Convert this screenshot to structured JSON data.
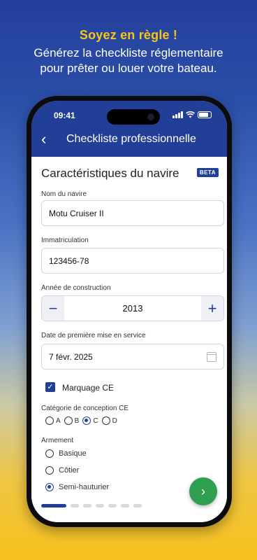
{
  "promo": {
    "headline": "Soyez en règle !",
    "subline1": "Générez la checkliste réglementaire",
    "subline2": "pour prêter ou louer votre bateau."
  },
  "status_bar": {
    "time": "09:41"
  },
  "app_bar": {
    "back_icon": "‹",
    "title": "Checkliste professionnelle"
  },
  "section": {
    "title": "Caractéristiques du navire",
    "badge": "BETA"
  },
  "form": {
    "vessel_name": {
      "label": "Nom du navire",
      "value": "Motu Cruiser II"
    },
    "registration": {
      "label": "Immatriculation",
      "value": "123456-78"
    },
    "build_year": {
      "label": "Année de construction",
      "value": "2013",
      "minus": "−",
      "plus": "+"
    },
    "service_date": {
      "label": "Date de première mise en service",
      "value": "7 févr. 2025"
    },
    "ce_marking": {
      "label": "Marquage CE",
      "checked": true,
      "check": "✓"
    },
    "design_category": {
      "label": "Catégorie de conception CE",
      "options": [
        "A",
        "B",
        "C",
        "D"
      ],
      "selected": "C"
    },
    "armament": {
      "label": "Armement",
      "options": [
        "Basique",
        "Côtier",
        "Semi-hauturier"
      ],
      "selected": "Semi-hauturier"
    }
  },
  "pager": {
    "pages": 7,
    "current": 1
  },
  "next_button": {
    "icon": "›"
  },
  "colors": {
    "primary": "#223f97",
    "accent_yellow": "#f5c518",
    "fab_green": "#2e9e4f"
  }
}
